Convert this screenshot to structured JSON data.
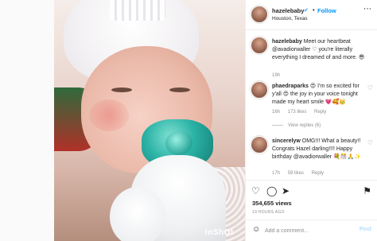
{
  "post": {
    "username": "hazelebaby",
    "verified_badge": "✔",
    "separator": "•",
    "follow_label": "Follow",
    "location": "Houston, Texas",
    "more_icon": "⋯",
    "watermark": "InShOt"
  },
  "caption": {
    "username": "hazelebaby",
    "text": "Meet our heartbeat @avadiorwaller ♡ you're literally everything I dreamed of and more. 😎",
    "time": "19h"
  },
  "comments": [
    {
      "username": "phaedraparks",
      "text": "😍 I'm so excited for y'all 😍 the joy in your voice tonight made my heart smile 💗🥰👑",
      "time": "16h",
      "likes": "173 likes",
      "reply_label": "Reply",
      "view_replies": "View replies (6)"
    },
    {
      "username": "sincerelyw",
      "text": "OMG!!! What a beauty!! Congrats Hazel darling!!!! Happy birthday @avadiorwaller 💐🎊🙏✨",
      "time": "17h",
      "likes": "59 likes",
      "reply_label": "Reply"
    }
  ],
  "actions": {
    "like_icon": "♡",
    "comment_icon": "◯",
    "share_icon": "➤",
    "save_icon": "⚑"
  },
  "likes_count": "354,655 views",
  "timestamp": "19 HOURS AGO",
  "add_comment": {
    "emoji_icon": "☺",
    "placeholder": "Add a comment...",
    "post_label": "Post"
  },
  "colors": {
    "link_blue": "#0095f6",
    "verified_blue": "#3897f0",
    "muted": "#8e8e8e",
    "post_disabled": "#b2dffc"
  }
}
